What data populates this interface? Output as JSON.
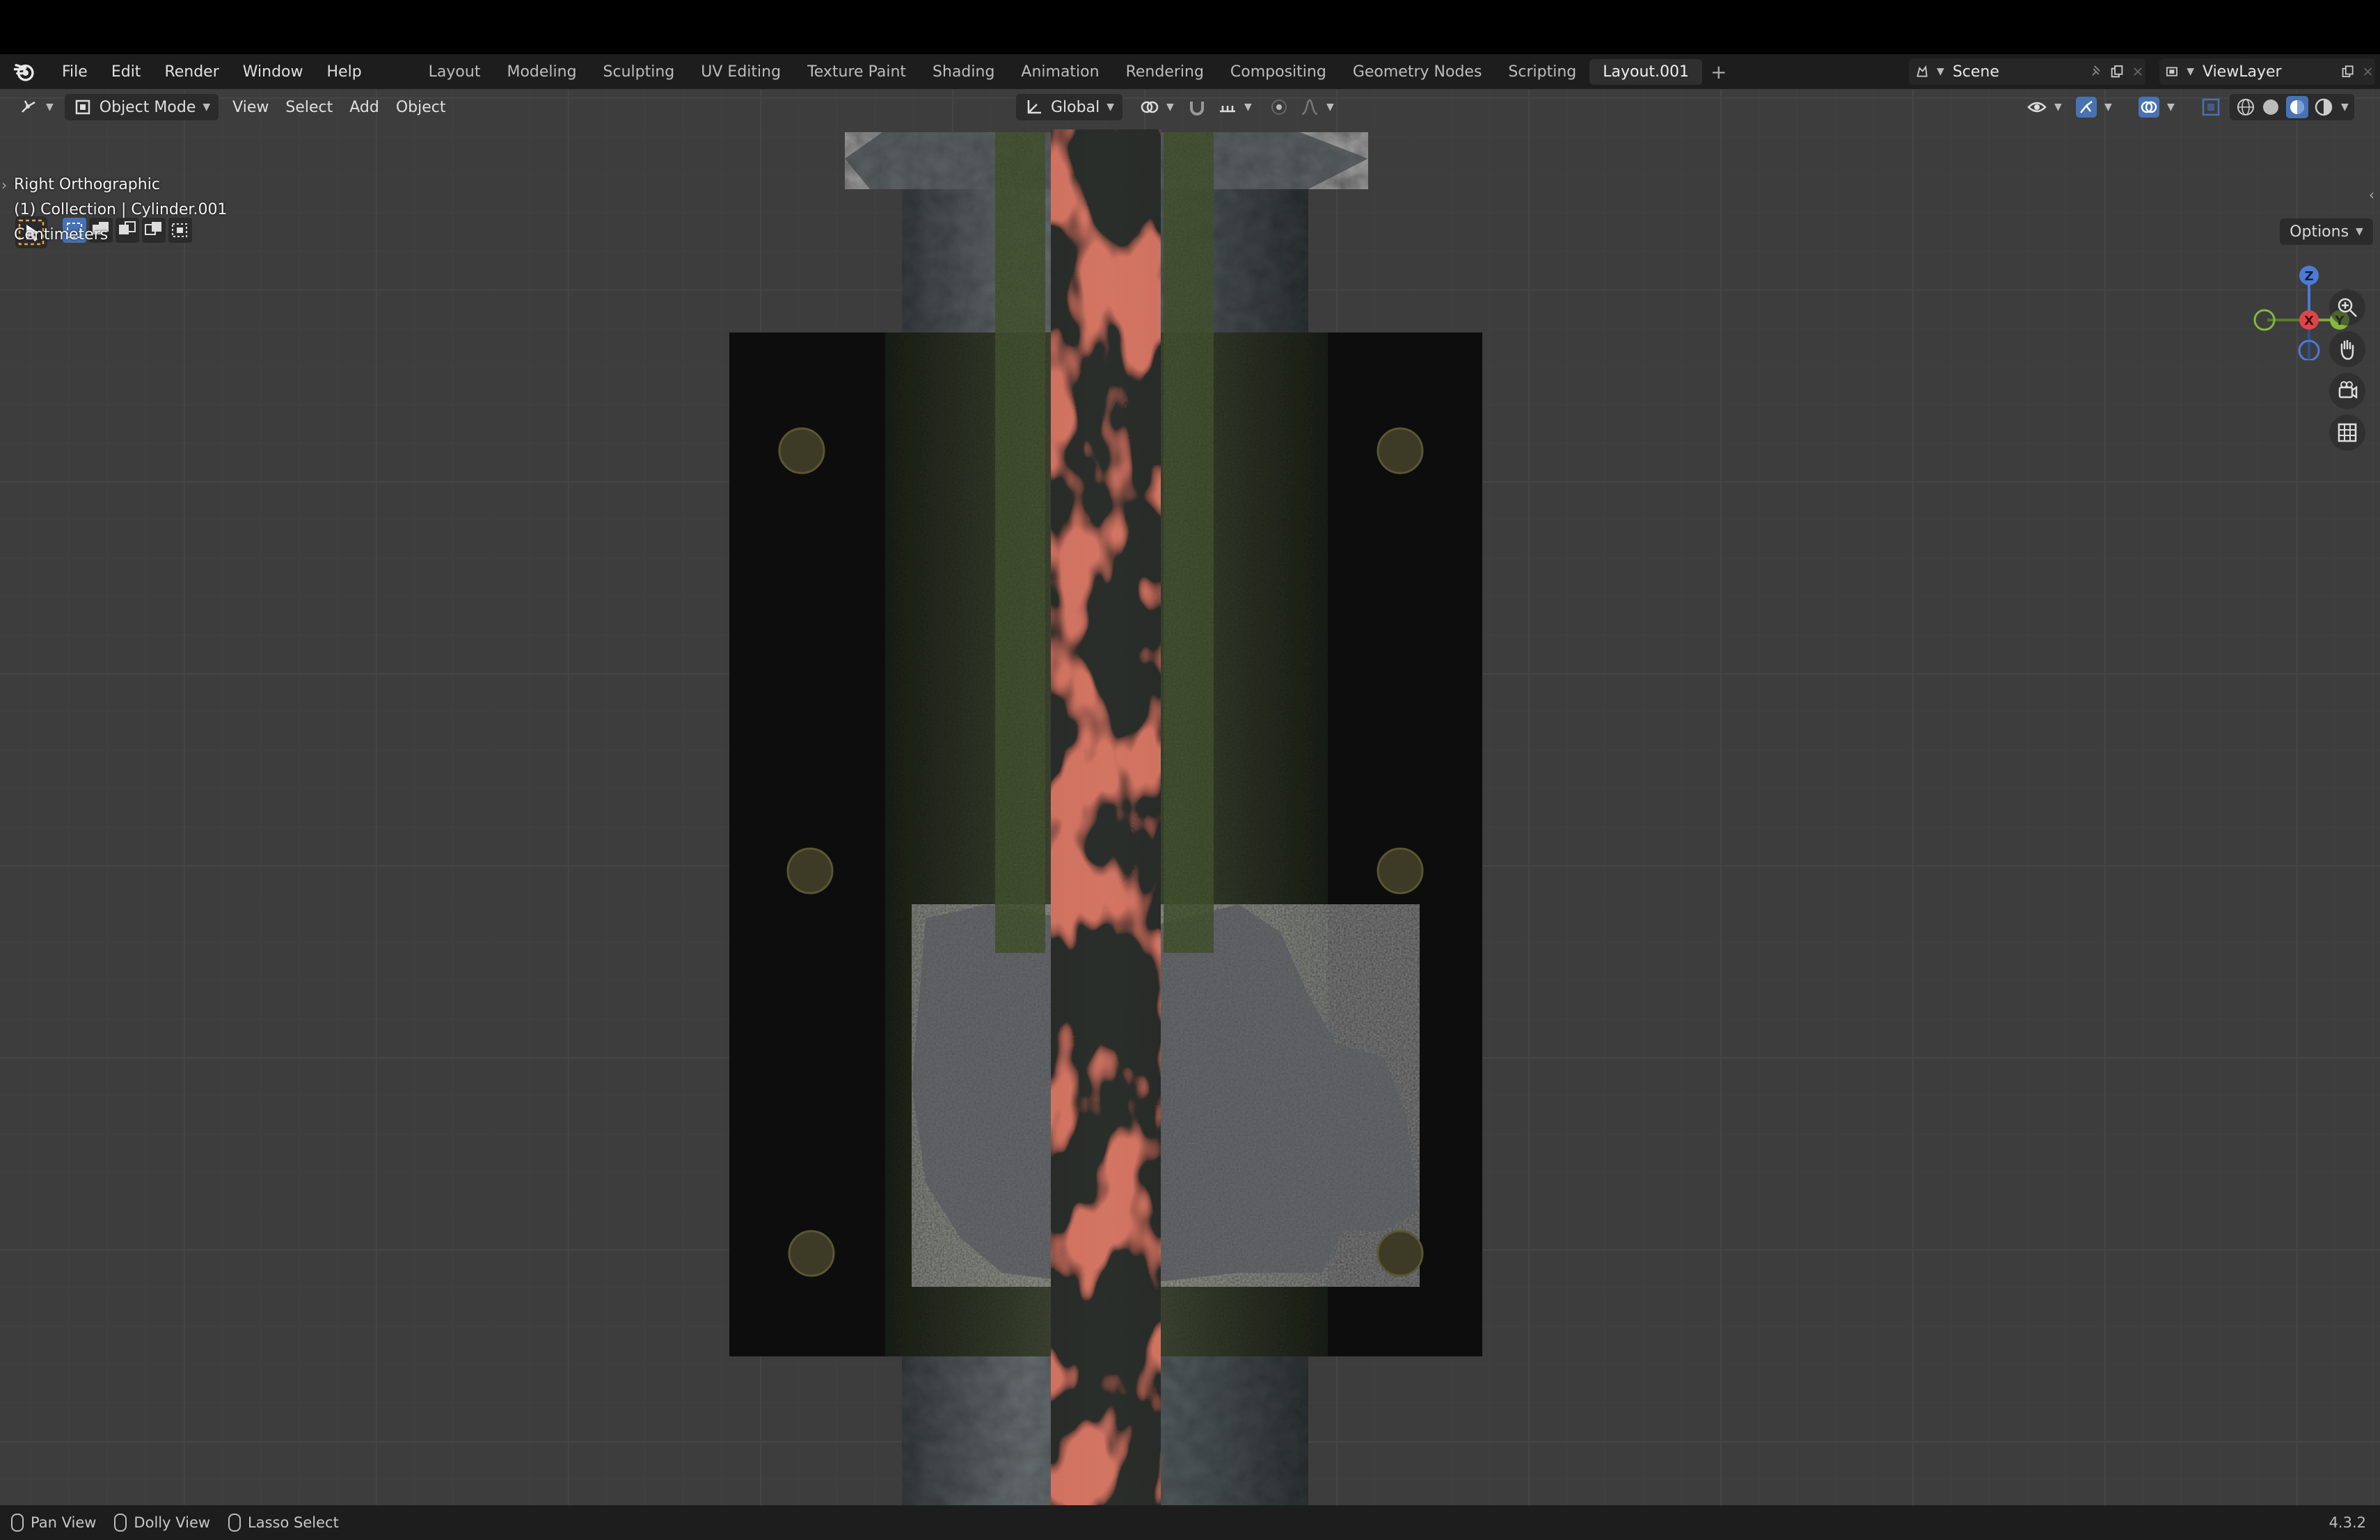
{
  "menu": {
    "items": [
      "File",
      "Edit",
      "Render",
      "Window",
      "Help"
    ]
  },
  "workspace_tabs": [
    "Layout",
    "Modeling",
    "Sculpting",
    "UV Editing",
    "Texture Paint",
    "Shading",
    "Animation",
    "Rendering",
    "Compositing",
    "Geometry Nodes",
    "Scripting",
    "Layout.001"
  ],
  "active_tab": "Layout.001",
  "scene_name": "Scene",
  "view_layer": "ViewLayer",
  "viewport_header": {
    "mode": "Object Mode",
    "menus": [
      "View",
      "Select",
      "Add",
      "Object"
    ],
    "orientation": "Global",
    "options_label": "Options"
  },
  "overlay": {
    "view_name": "Right Orthographic",
    "collection": "(1) Collection | Cylinder.001",
    "units": "Centimeters"
  },
  "gizmo": {
    "z": "Z",
    "x": "X",
    "y": "Y"
  },
  "statusbar": {
    "pan": "Pan View",
    "dolly": "Dolly View",
    "lasso": "Lasso Select",
    "version": "4.3.2"
  },
  "colors": {
    "accent": "#4772b3",
    "lava": "#c0392b"
  }
}
